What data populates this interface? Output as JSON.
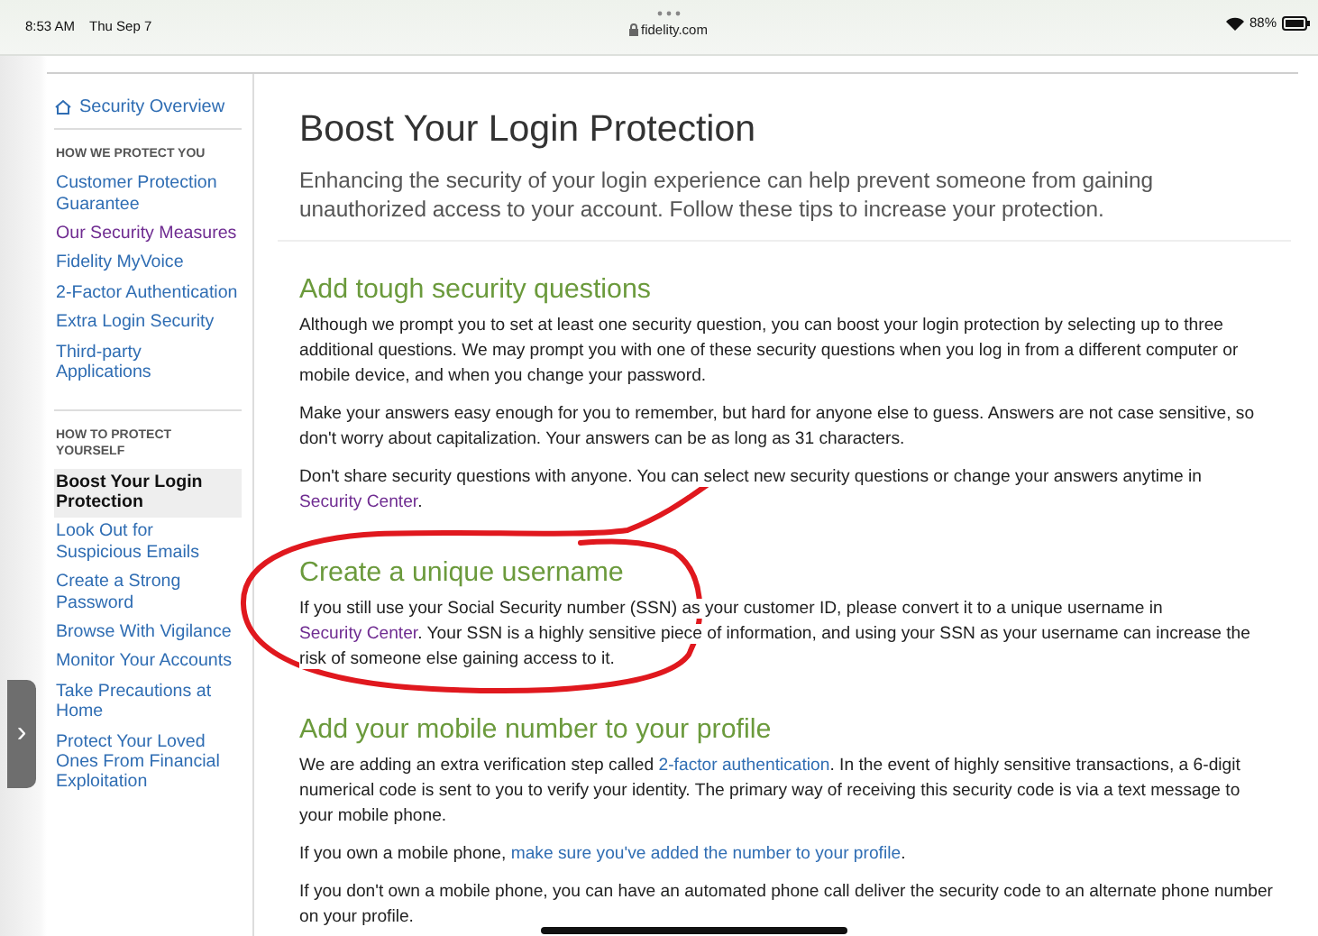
{
  "status_bar": {
    "time": "8:53 AM",
    "date": "Thu Sep 7",
    "url": "fidelity.com",
    "battery": "88%"
  },
  "sidebar": {
    "overview": {
      "label": "Security Overview"
    },
    "sections": [
      {
        "heading": "HOW WE PROTECT YOU",
        "items": [
          {
            "label": "Customer Protection Guarantee",
            "selected": false,
            "visited": false
          },
          {
            "label": "Our Security Measures",
            "selected": false,
            "visited": true
          },
          {
            "label": "Fidelity MyVoice",
            "selected": false,
            "visited": false
          },
          {
            "label": "2-Factor Authentication",
            "selected": false,
            "visited": false
          },
          {
            "label": "Extra Login Security",
            "selected": false,
            "visited": false
          },
          {
            "label": "Third-party Applications",
            "selected": false,
            "visited": false
          }
        ]
      },
      {
        "heading": "HOW TO PROTECT YOURSELF",
        "items": [
          {
            "label": "Boost Your Login Protection",
            "selected": true,
            "visited": false
          },
          {
            "label": "Look Out for Suspicious Emails",
            "selected": false,
            "visited": false
          },
          {
            "label": "Create a Strong Password",
            "selected": false,
            "visited": false
          },
          {
            "label": "Browse With Vigilance",
            "selected": false,
            "visited": false
          },
          {
            "label": "Monitor Your Accounts",
            "selected": false,
            "visited": false
          },
          {
            "label": "Take Precautions at Home",
            "selected": false,
            "visited": false
          },
          {
            "label": "Protect Your Loved Ones From Financial Exploitation",
            "selected": false,
            "visited": false
          }
        ]
      }
    ]
  },
  "main": {
    "title": "Boost Your Login Protection",
    "intro": "Enhancing the security of your login experience can help prevent someone from gaining unauthorized access to your account. Follow these tips to increase your protection.",
    "sections": [
      {
        "heading": "Add tough security questions",
        "circled": false,
        "paragraphs": [
          [
            {
              "text": "Although we prompt you to set at least one security question, you can boost your login protection by selecting up to three additional questions. We may prompt you with one of these security questions when you log in from a different computer or mobile device, and when you change your password."
            }
          ],
          [
            {
              "text": "Make your answers easy enough for you to remember, but hard for anyone else to guess. Answers are not case sensitive, so don't worry about capitalization. Your answers can be as long as 31 characters."
            }
          ],
          [
            {
              "text": "Don't share security questions with anyone. You can select new security questions or change your answers anytime in "
            },
            {
              "text": "Security Center",
              "link": true,
              "visited": true
            },
            {
              "text": "."
            }
          ]
        ]
      },
      {
        "heading": "Create a unique username",
        "circled": true,
        "paragraphs": [
          [
            {
              "text": "If you still use your Social Security number (SSN) as your customer ID, please convert it to a unique username in "
            },
            {
              "text": "Security Center",
              "link": true,
              "visited": true
            },
            {
              "text": ". Your SSN is a highly sensitive piece of information, and using your SSN as your username can increase the risk of someone else gaining access to it."
            }
          ]
        ]
      },
      {
        "heading": "Add your mobile number to your profile",
        "circled": false,
        "paragraphs": [
          [
            {
              "text": "We are adding an extra verification step called "
            },
            {
              "text": "2-factor authentication",
              "link": true,
              "visited": false
            },
            {
              "text": ". In the event of highly sensitive transactions, a 6-digit numerical code is sent to you to verify your identity. The primary way of receiving this security code is via a text message to your mobile phone."
            }
          ],
          [
            {
              "text": "If you own a mobile phone, "
            },
            {
              "text": "make sure you've added the number to your profile",
              "link": true,
              "visited": false
            },
            {
              "text": "."
            }
          ],
          [
            {
              "text": "If you don't own a mobile phone, you can have an automated phone call deliver the security code to an alternate phone number on your profile."
            }
          ]
        ]
      }
    ]
  },
  "side_handle": {
    "label": "›"
  }
}
